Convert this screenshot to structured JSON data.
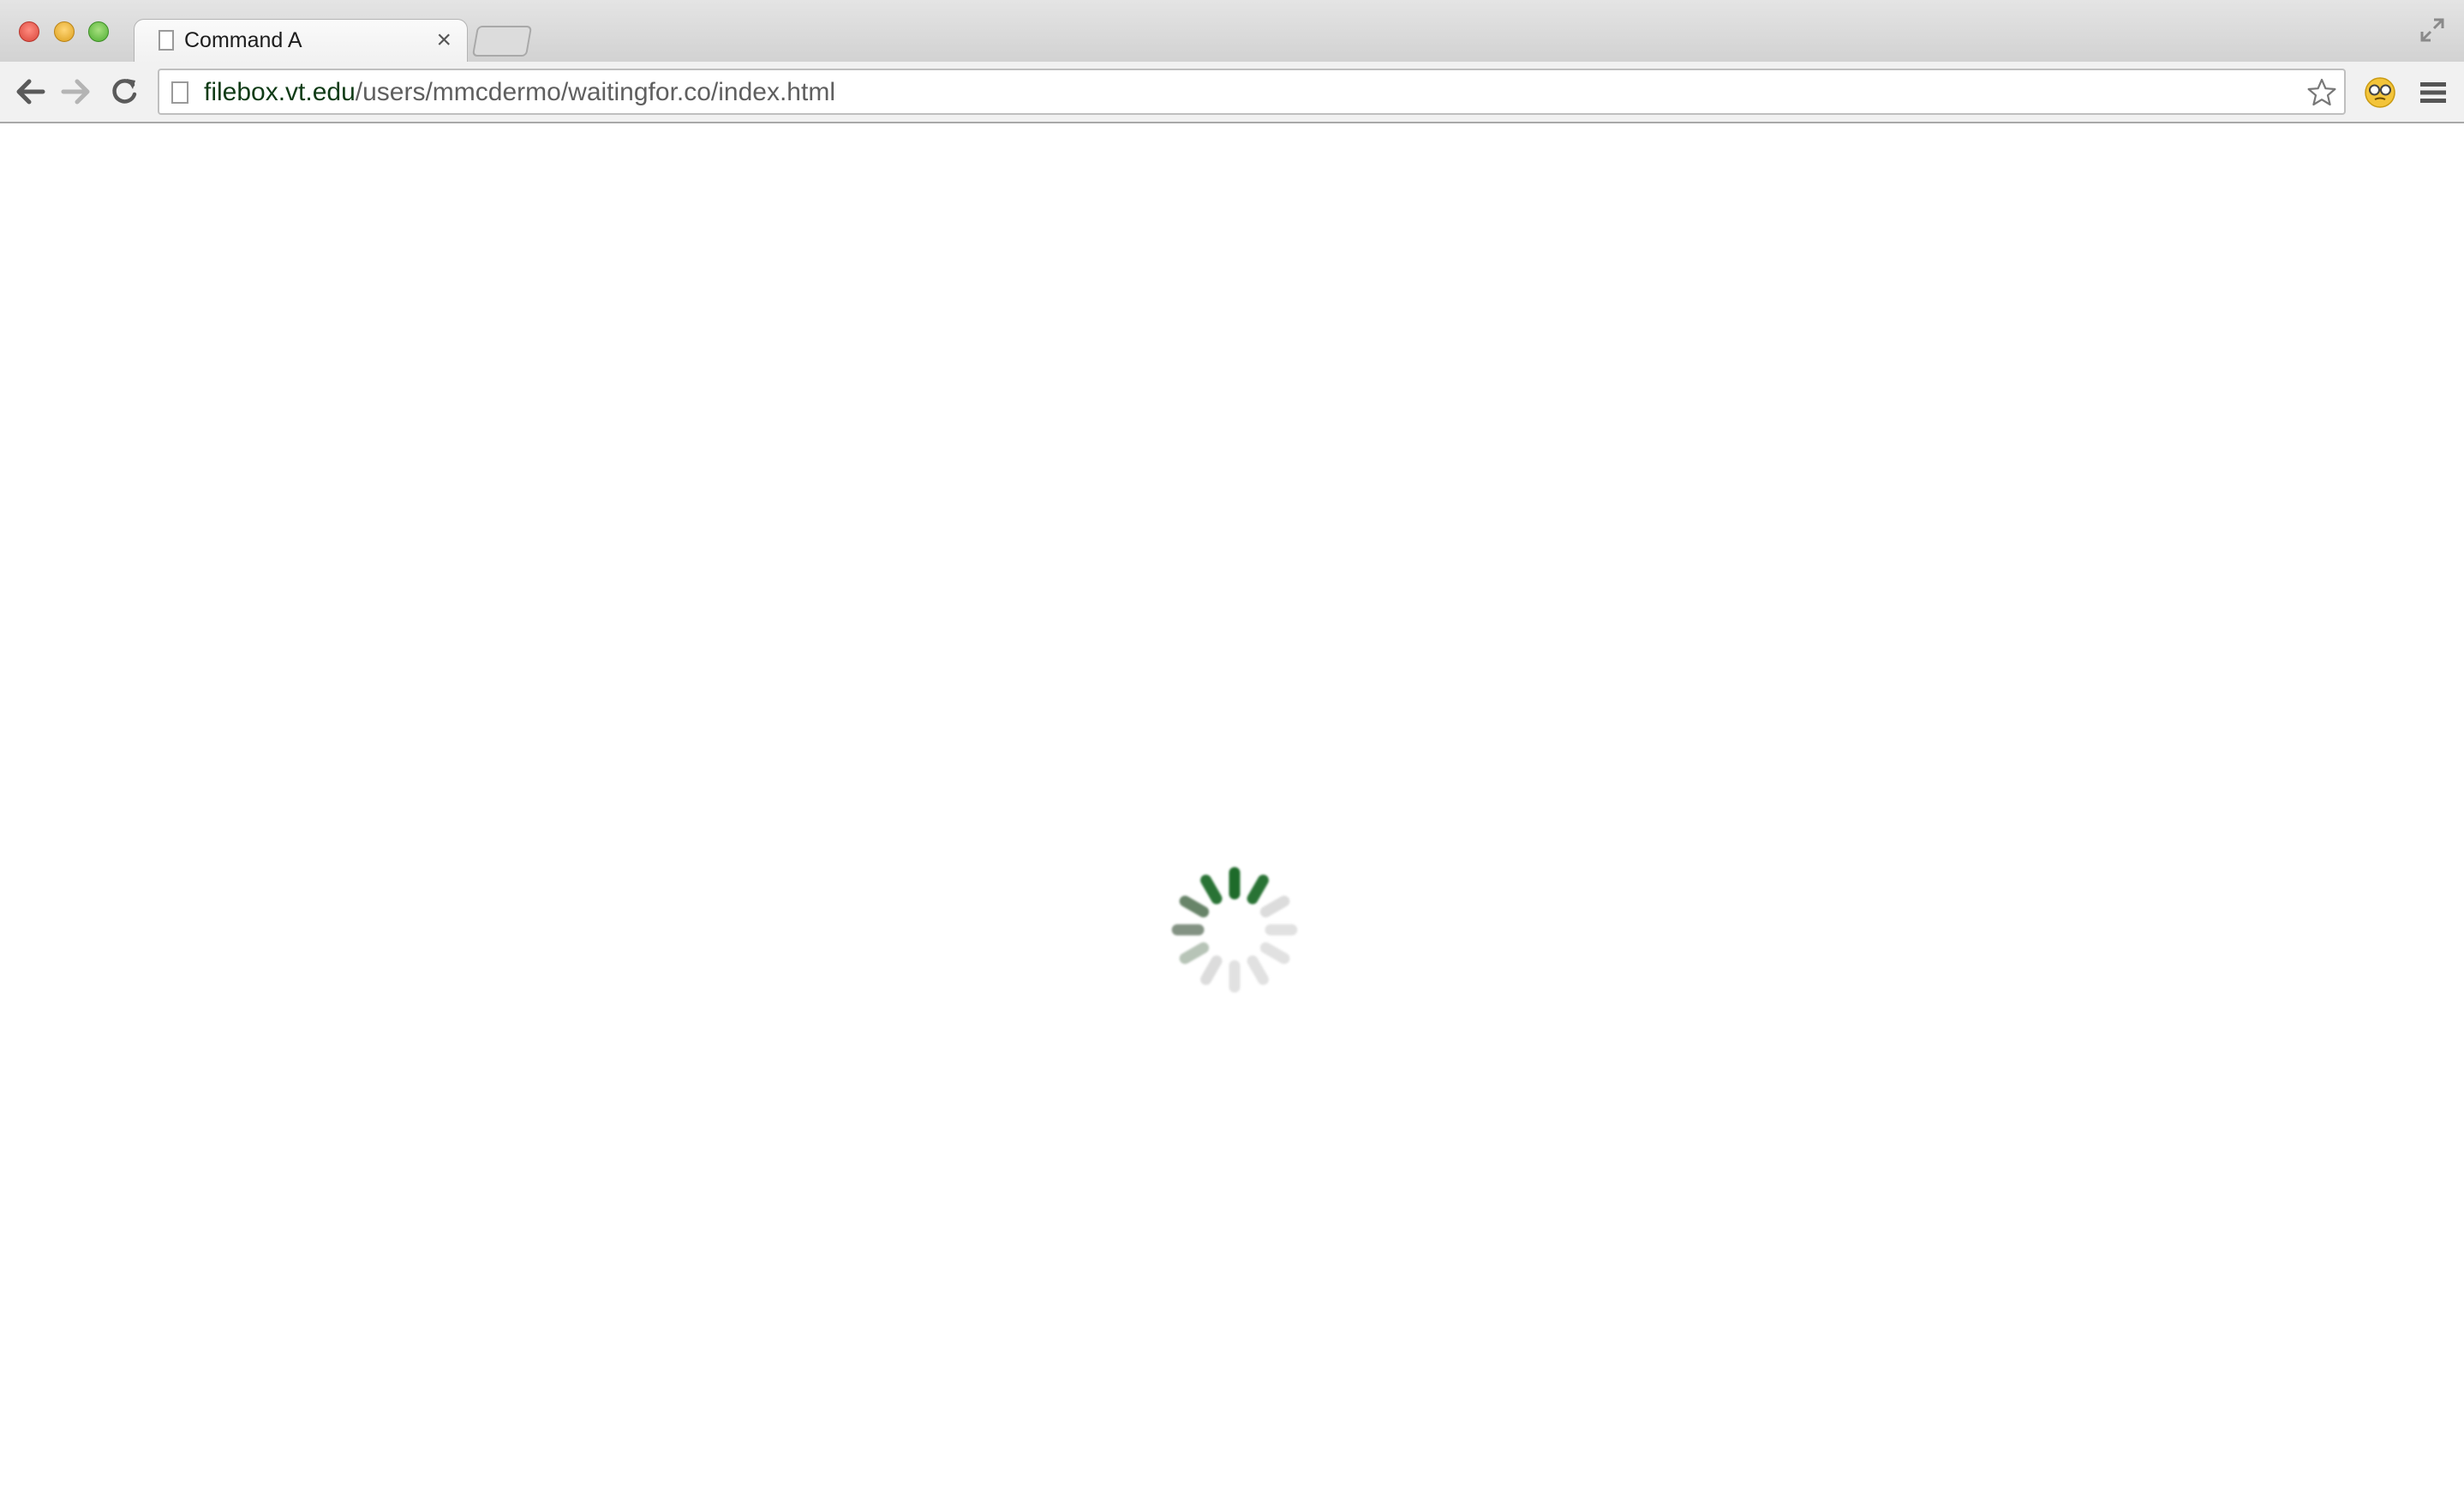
{
  "browser": {
    "tab": {
      "title": "Command A",
      "close_glyph": "×"
    },
    "omnibox": {
      "host": "filebox.vt.edu",
      "path": "/users/mmcdermo/waitingfor.co/index.html"
    },
    "icons": {
      "back": "back-arrow-icon",
      "forward": "forward-arrow-icon",
      "reload": "reload-icon",
      "bookmark": "star-icon",
      "extension": "extension-face-icon",
      "menu": "hamburger-menu-icon",
      "fullscreen": "fullscreen-icon",
      "page": "page-icon"
    }
  },
  "content": {
    "loading_spinner": {
      "spoke_count": 12,
      "accent": "#1e6b2a"
    }
  },
  "colors": {
    "host_text": "#0f3b16",
    "path_text": "#5f5f5f",
    "spinner_accent": "#1e6b2a"
  }
}
